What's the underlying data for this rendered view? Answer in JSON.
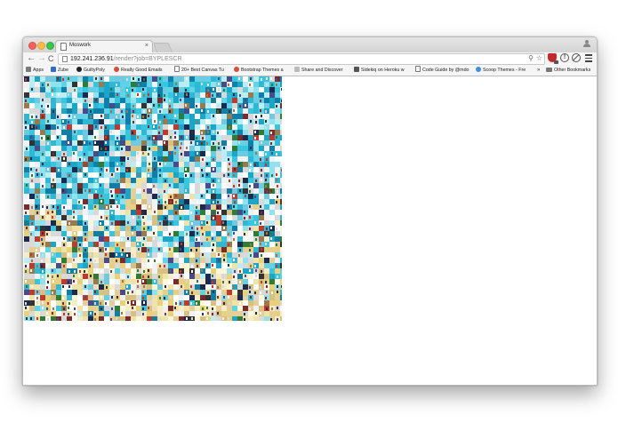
{
  "tab": {
    "title": "Moswork",
    "close_glyph": "×",
    "icon": "document-icon"
  },
  "toolbar": {
    "back_glyph": "←",
    "forward_glyph": "→",
    "reload_glyph": "C",
    "url_host": "192.241.236.91",
    "url_path": "/render?job=BYPLESCR",
    "search_glyph": "⚲",
    "star_glyph": "☆",
    "info_glyph": "!"
  },
  "bookmarks": {
    "items": [
      {
        "label": "Apps",
        "icon": "apps-grid-icon",
        "color": "#7a7a7a"
      },
      {
        "label": "Zube",
        "icon": "zube-icon",
        "color": "#2d6fd6"
      },
      {
        "label": "GuiltyPoly",
        "icon": "github-icon",
        "color": "#222222"
      },
      {
        "label": "Really Good Emails",
        "icon": "emails-icon",
        "color": "#e0483c"
      },
      {
        "label": "20+ Best Canvas Tu",
        "icon": "document-icon",
        "color": "#ffffff"
      },
      {
        "label": "Bootstrap Themes a",
        "icon": "bootstrap-icon",
        "color": "#e04a3a"
      },
      {
        "label": "Share and Discover",
        "icon": "discover-icon",
        "color": "#bbbbbb"
      },
      {
        "label": "Sidekiq on Heroku w",
        "icon": "sidekiq-icon",
        "color": "#555555"
      },
      {
        "label": "Code Guide by @mdo",
        "icon": "document-icon",
        "color": "#ffffff"
      },
      {
        "label": "Scoop Themes - Fre",
        "icon": "scoop-icon",
        "color": "#3d8fe0"
      }
    ],
    "more_glyph": "»",
    "other_label": "Other Bookmarks"
  },
  "mosaic": {
    "description_icon": "photo-mosaic-image"
  }
}
